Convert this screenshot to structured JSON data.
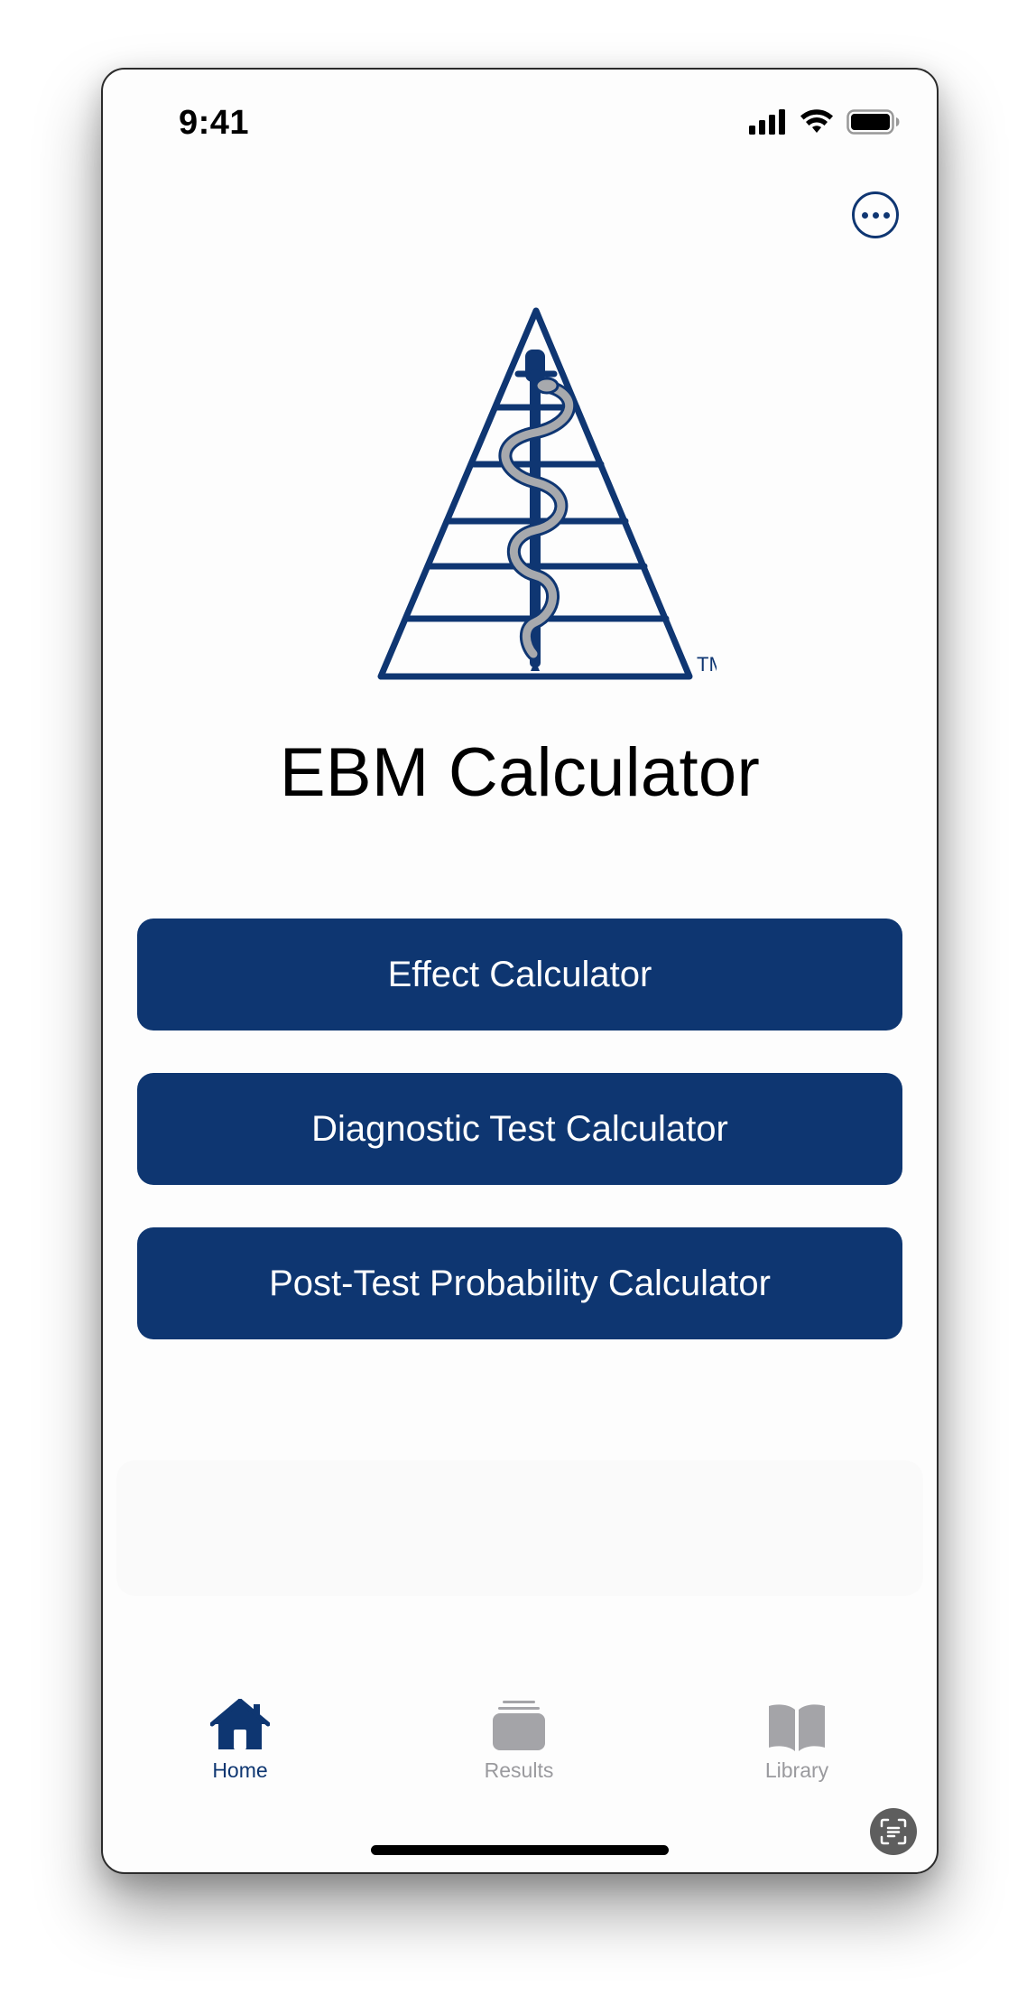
{
  "status_bar": {
    "time": "9:41",
    "icons": [
      "signal-icon",
      "wifi-icon",
      "battery-icon"
    ]
  },
  "header": {
    "more_icon": "ellipsis-circle-icon"
  },
  "logo": {
    "icon": "pyramid-rod-of-asclepius-logo",
    "trademark": "TM"
  },
  "app": {
    "title": "EBM Calculator"
  },
  "buttons": [
    {
      "label": "Effect Calculator"
    },
    {
      "label": "Diagnostic Test Calculator"
    },
    {
      "label": "Post-Test Probability Calculator"
    }
  ],
  "tabbar": {
    "tabs": [
      {
        "label": "Home",
        "icon": "house-icon",
        "active": true
      },
      {
        "label": "Results",
        "icon": "stack-icon",
        "active": false
      },
      {
        "label": "Library",
        "icon": "book-icon",
        "active": false
      }
    ]
  },
  "colors": {
    "accent": "#0e3671",
    "inactive_tab": "#9a9a9e",
    "background": "#fdfdfd"
  }
}
